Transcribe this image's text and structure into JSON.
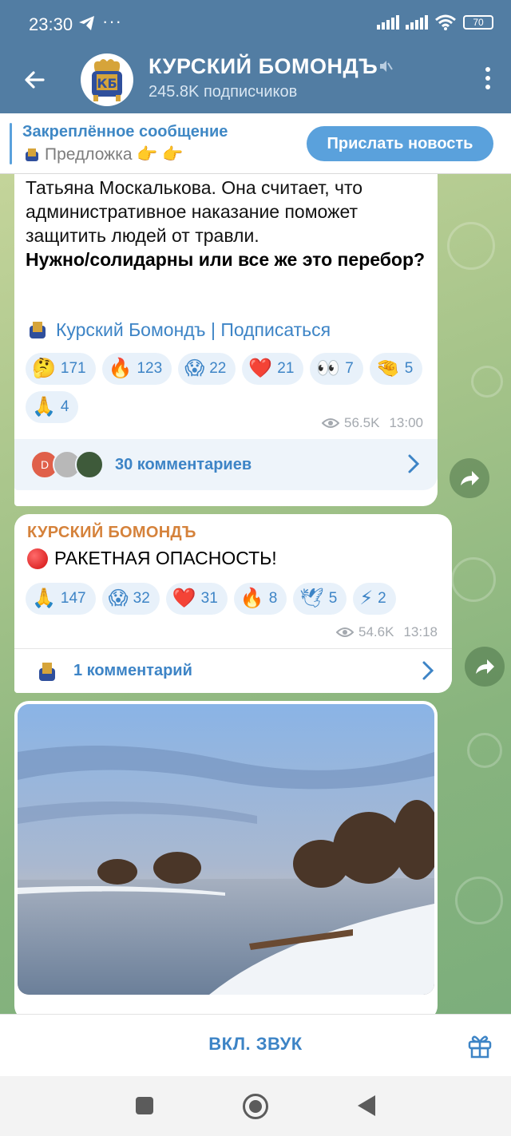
{
  "status_bar": {
    "time": "23:30",
    "more": "···",
    "battery": "70"
  },
  "header": {
    "title": "КУРСКИЙ БОМОНДЪ",
    "subtitle": "245.8K подписчиков"
  },
  "pinned": {
    "title": "Закреплённое сообщение",
    "text": "Предложка 👉 👉",
    "button": "Прислать новость"
  },
  "messages": [
    {
      "text": "Татьяна Москалькова. Она считает, что административное наказание поможет защитить людей от травли.",
      "bold_text": "Нужно/солидарны или все же это перебор?",
      "signature": "Курский Бомондъ | Подписаться",
      "reactions": [
        {
          "emoji": "🤔",
          "count": "171"
        },
        {
          "emoji": "🔥",
          "count": "123"
        },
        {
          "emoji": "😱",
          "count": "22"
        },
        {
          "emoji": "❤️",
          "count": "21"
        },
        {
          "emoji": "👀",
          "count": "7"
        },
        {
          "emoji": "🤏",
          "count": "5"
        },
        {
          "emoji": "🙏",
          "count": "4"
        }
      ],
      "views": "56.5K",
      "time": "13:00",
      "comments": "30 комментариев",
      "comment_avatar_letter": "D"
    },
    {
      "author": "КУРСКИЙ БОМОНДЪ",
      "text": "РАКЕТНАЯ ОПАСНОСТЬ!",
      "reactions": [
        {
          "emoji": "🙏",
          "count": "147"
        },
        {
          "emoji": "😱",
          "count": "32"
        },
        {
          "emoji": "❤️",
          "count": "31"
        },
        {
          "emoji": "🔥",
          "count": "8"
        },
        {
          "emoji": "🕊",
          "count": "5"
        },
        {
          "emoji": "⚡",
          "count": "2"
        }
      ],
      "views": "54.6K",
      "time": "13:18",
      "comments": "1 комментарий"
    }
  ],
  "bottom": {
    "sound_button": "ВКЛ. ЗВУК"
  },
  "colors": {
    "header": "#527da3",
    "accent": "#3d84c6",
    "author": "#d5823b"
  }
}
